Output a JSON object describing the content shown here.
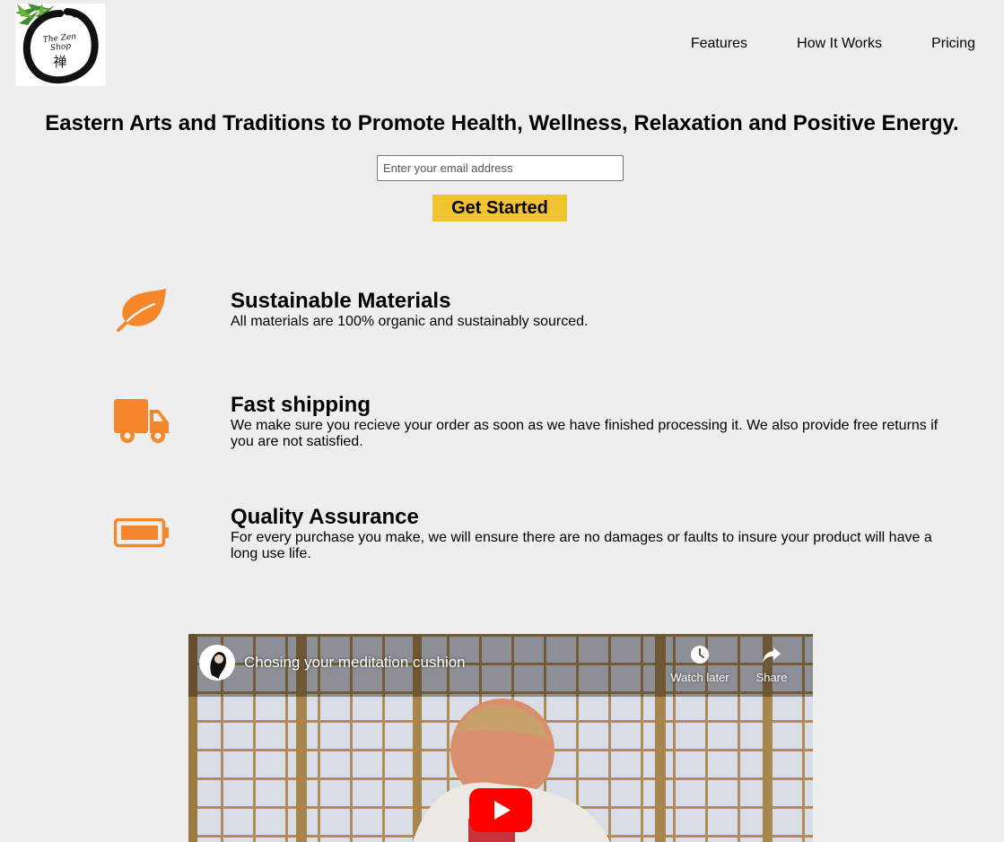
{
  "header": {
    "logo": {
      "text": "The Zen Shop",
      "kanji": "禅"
    },
    "nav": [
      {
        "label": "Features"
      },
      {
        "label": "How It Works"
      },
      {
        "label": "Pricing"
      }
    ]
  },
  "hero": {
    "title": "Eastern Arts and Traditions to Promote Health, Wellness, Relaxation and Positive Energy.",
    "email_placeholder": "Enter your email address",
    "cta_label": "Get Started"
  },
  "features": [
    {
      "icon": "leaf-icon",
      "title": "Sustainable Materials",
      "description": "All materials are 100% organic and sustainably sourced."
    },
    {
      "icon": "truck-icon",
      "title": "Fast shipping",
      "description": "We make sure you recieve your order as soon as we have finished processing it. We also provide free returns if you are not satisfied."
    },
    {
      "icon": "battery-full-icon",
      "title": "Quality Assurance",
      "description": "For every purchase you make, we will ensure there are no damages or faults to insure your product will have a long use life."
    }
  ],
  "video": {
    "title": "Chosing your meditation cushion",
    "watch_later_label": "Watch later",
    "share_label": "Share"
  },
  "colors": {
    "background": "#eeeeee",
    "accent_orange": "#f5872a",
    "cta_yellow": "#f0c330",
    "play_red": "#ff0000"
  }
}
